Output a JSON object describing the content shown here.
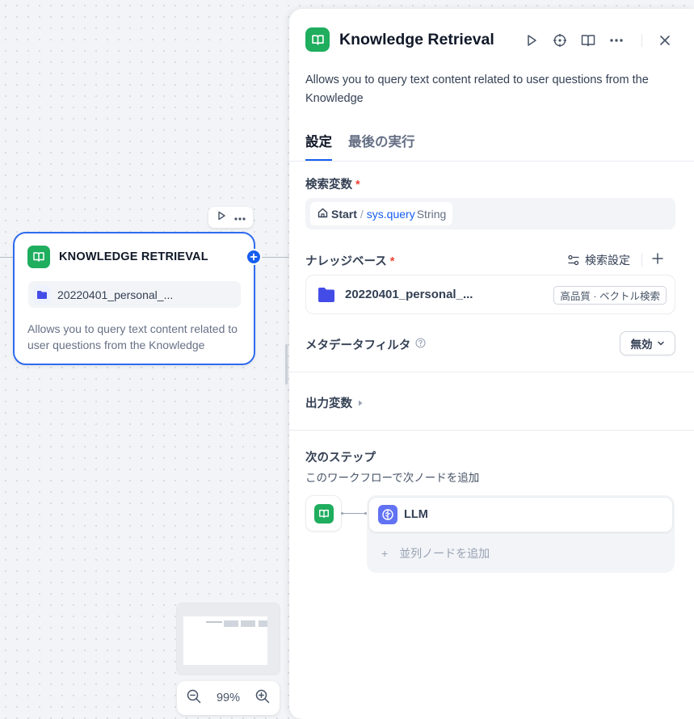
{
  "canvas": {
    "node": {
      "title": "KNOWLEDGE RETRIEVAL",
      "kb_name": "20220401_personal_...",
      "description": "Allows you to query text content related to user questions from the Knowledge"
    },
    "zoom": "99%"
  },
  "panel": {
    "title": "Knowledge Retrieval",
    "description": "Allows you to query text content related to user questions from the Knowledge",
    "tabs": [
      {
        "label": "設定",
        "active": true
      },
      {
        "label": "最後の実行",
        "active": false
      }
    ],
    "query_variable": {
      "label": "検索変数",
      "required_mark": "*",
      "source_node": "Start",
      "separator": "/",
      "variable": "sys.query",
      "type": "String"
    },
    "knowledge_base": {
      "label": "ナレッジベース",
      "required_mark": "*",
      "settings_label": "検索設定",
      "item_name": "20220401_personal_...",
      "item_badge": "高品質 · ベクトル検索"
    },
    "metadata_filter": {
      "label": "メタデータフィルタ",
      "value": "無効"
    },
    "output_vars": {
      "label": "出力変数"
    },
    "next_step": {
      "title": "次のステップ",
      "description": "このワークフローで次ノードを追加",
      "next_node_label": "LLM",
      "add_parallel_label": "並列ノードを追加",
      "add_parallel_plus": "+"
    }
  },
  "colors": {
    "accent": "#155eef",
    "knowledge_icon": "#1fad5e",
    "llm_icon": "#6172f3",
    "kb_folder": "#444ce7",
    "required": "#f04438"
  }
}
